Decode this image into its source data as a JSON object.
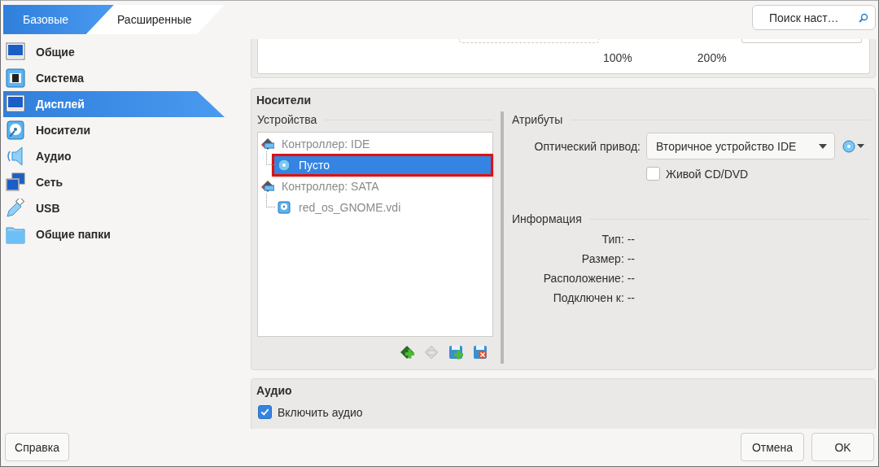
{
  "tabs": [
    {
      "label": "Базовые",
      "selected": true
    },
    {
      "label": "Расширенные",
      "selected": false
    }
  ],
  "sidebar": {
    "items": [
      {
        "label": "Общие",
        "kind": "general",
        "selected": false
      },
      {
        "label": "Система",
        "kind": "system",
        "selected": false
      },
      {
        "label": "Дисплей",
        "kind": "display",
        "selected": true
      },
      {
        "label": "Носители",
        "kind": "storage",
        "selected": false
      },
      {
        "label": "Аудио",
        "kind": "audio",
        "selected": false
      },
      {
        "label": "Сеть",
        "kind": "network",
        "selected": false
      },
      {
        "label": "USB",
        "kind": "usb",
        "selected": false
      },
      {
        "label": "Общие папки",
        "kind": "shared",
        "selected": false
      }
    ]
  },
  "search": {
    "placeholder": "Поиск наст…"
  },
  "display": {
    "scale_labels": [
      "100%",
      "200%"
    ]
  },
  "storage": {
    "title": "Носители",
    "devices_label": "Устройства",
    "tree": [
      {
        "label": "Контроллер: IDE",
        "kind": "controller",
        "selected": false,
        "children": [
          {
            "label": "Пусто",
            "kind": "optical",
            "selected": true
          }
        ]
      },
      {
        "label": "Контроллер: SATA",
        "kind": "controller",
        "selected": false,
        "children": [
          {
            "label": "red_os_GNOME.vdi",
            "kind": "disk",
            "selected": false
          }
        ]
      }
    ],
    "toolbar": [
      {
        "kind": "add-controller",
        "disabled": false
      },
      {
        "kind": "remove-controller",
        "disabled": true
      },
      {
        "kind": "add-attachment",
        "disabled": false
      },
      {
        "kind": "remove-attachment",
        "disabled": false
      }
    ],
    "attributes_label": "Атрибуты",
    "optical_drive": {
      "label": "Оптический привод:",
      "value": "Вторичное устройство IDE"
    },
    "live_cd": {
      "label": "Живой CD/DVD",
      "checked": false
    },
    "info_label": "Информация",
    "info": [
      "Тип: --",
      "Размер: --",
      "Расположение: --",
      "Подключен к: --"
    ]
  },
  "audio": {
    "title": "Аудио",
    "enable": {
      "label": "Включить аудио",
      "checked": true
    }
  },
  "buttons": {
    "help": "Справка",
    "cancel": "Отмена",
    "ok": "OK"
  }
}
